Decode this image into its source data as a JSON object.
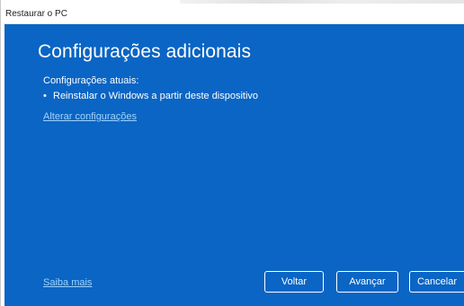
{
  "window": {
    "title": "Restaurar o PC"
  },
  "dialog": {
    "heading": "Configurações adicionais",
    "current_settings_label": "Configurações atuais:",
    "bullet_symbol": "•",
    "current_settings": [
      "Reinstalar o Windows a partir deste dispositivo"
    ],
    "change_settings_link": "Alterar configurações",
    "learn_more_link": "Saiba mais"
  },
  "buttons": {
    "back": "Voltar",
    "next": "Avançar",
    "cancel": "Cancelar"
  },
  "colors": {
    "dialog_background": "#0a65c4",
    "text": "#ffffff",
    "link": "#9fd2ff"
  }
}
